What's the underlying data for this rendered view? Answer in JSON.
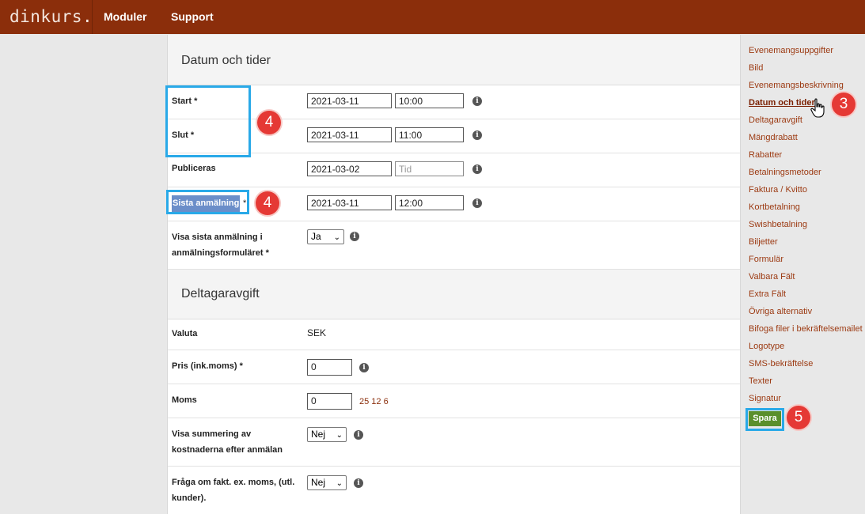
{
  "header": {
    "logo": "dinkurs.",
    "nav": [
      "Moduler",
      "Support"
    ]
  },
  "dates_section": {
    "title": "Datum och tider",
    "start": {
      "label": "Start *",
      "date": "2021-03-11",
      "time": "10:00"
    },
    "slut": {
      "label": "Slut *",
      "date": "2021-03-11",
      "time": "11:00"
    },
    "publiceras": {
      "label": "Publiceras",
      "date": "2021-03-02",
      "time_placeholder": "Tid"
    },
    "sista": {
      "label": "Sista anmälning",
      "star": "*",
      "date": "2021-03-11",
      "time": "12:00"
    },
    "visa_sista": {
      "label_line1": "Visa sista anmälning i",
      "label_line2": "anmälningsformuläret *",
      "value": "Ja"
    }
  },
  "fee_section": {
    "title": "Deltagaravgift",
    "valuta": {
      "label": "Valuta",
      "value": "SEK"
    },
    "pris": {
      "label": "Pris (ink.moms) *",
      "value": "0"
    },
    "moms": {
      "label": "Moms",
      "value": "0",
      "options": "25 12 6"
    },
    "visa_summering": {
      "label_line1": "Visa summering av",
      "label_line2": "kostnaderna efter anmälan",
      "value": "Nej"
    },
    "fraga": {
      "label_line1": "Fråga om fakt. ex. moms, (utl.",
      "label_line2": "kunder).",
      "value": "Nej"
    }
  },
  "info_icon": "i",
  "sidebar": {
    "items": [
      "Evenemangsuppgifter",
      "Bild",
      "Evenemangsbeskrivning",
      "Datum och tider",
      "Deltagaravgift",
      "Mängdrabatt",
      "Rabatter",
      "Betalningsmetoder",
      "Faktura / Kvitto",
      "Kortbetalning",
      "Swishbetalning",
      "Biljetter",
      "Formulär",
      "Valbara Fält",
      "Extra Fält",
      "Övriga alternativ",
      "Bifoga filer i bekräftelsemailet",
      "Logotype",
      "SMS-bekräftelse",
      "Texter",
      "Signatur"
    ],
    "save_label": "Spara"
  },
  "annotations": {
    "badge_dates": "4",
    "badge_sista": "4",
    "badge_active": "3",
    "badge_save": "5",
    "color_box": "#29a9e8",
    "color_badge": "#e53935"
  }
}
